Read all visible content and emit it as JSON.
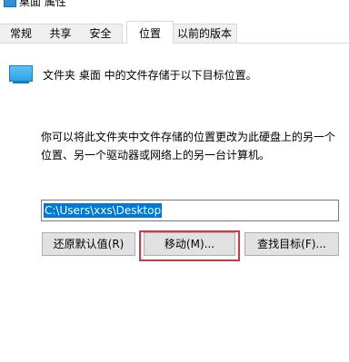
{
  "window": {
    "title": "桌面 属性"
  },
  "tabs": [
    {
      "label": "常规"
    },
    {
      "label": "共享"
    },
    {
      "label": "安全"
    },
    {
      "label": "位置",
      "active": true
    },
    {
      "label": "以前的版本"
    }
  ],
  "location": {
    "heading": "文件夹 桌面 中的文件存储于以下目标位置。",
    "description_line1": "你可以将此文件夹中文件存储的位置更改为此硬盘上的另一个",
    "description_line2": "位置、另一个驱动器或网络上的另一台计算机。",
    "path_value": "C:\\Users\\xxs\\Desktop"
  },
  "buttons": {
    "restore_default": "还原默认值(R)",
    "move": "移动(M)...",
    "find_target": "查找目标(F)..."
  },
  "icons": {
    "folder": "folder-icon",
    "highlight_color": "#d9363e",
    "selection_color": "#0078d7"
  }
}
